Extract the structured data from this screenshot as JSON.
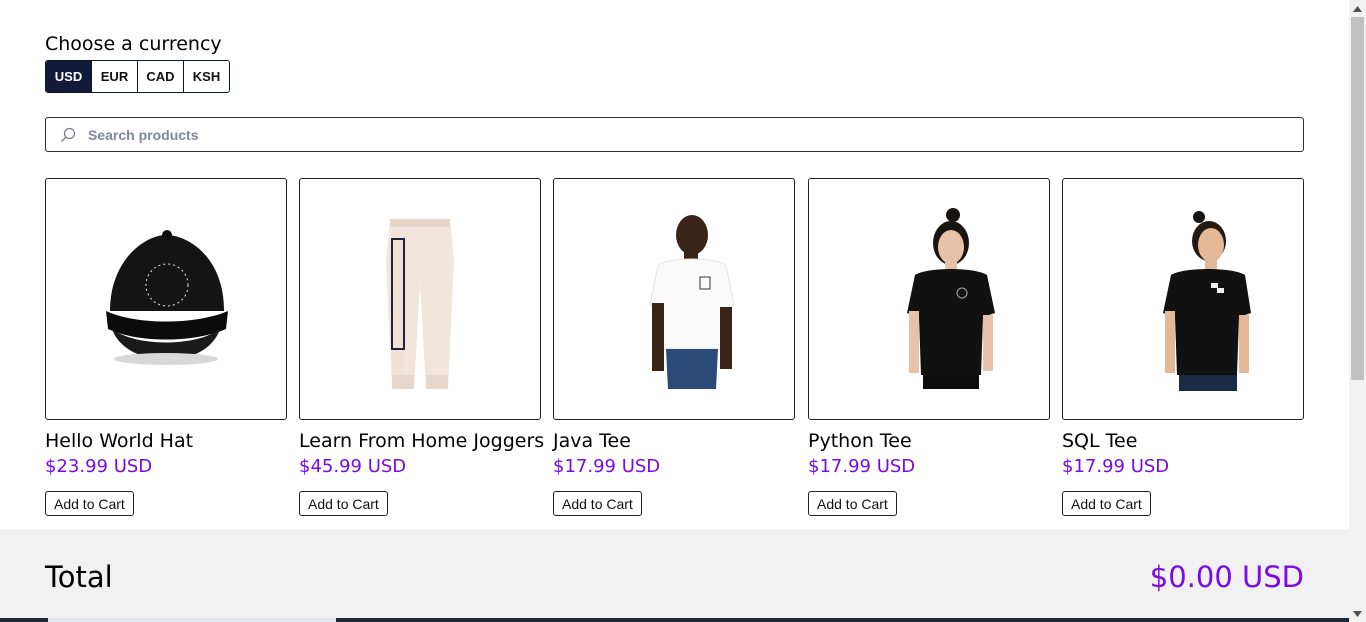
{
  "currency": {
    "title": "Choose a currency",
    "options": [
      "USD",
      "EUR",
      "CAD",
      "KSH"
    ],
    "selected": "USD"
  },
  "search": {
    "placeholder": "Search products",
    "value": ""
  },
  "products": [
    {
      "name": "Hello World Hat",
      "price": "$23.99 USD",
      "add_label": "Add to Cart",
      "image": "cap-photo"
    },
    {
      "name": "Learn From Home Joggers",
      "price": "$45.99 USD",
      "add_label": "Add to Cart",
      "image": "joggers-photo"
    },
    {
      "name": "Java Tee",
      "price": "$17.99 USD",
      "add_label": "Add to Cart",
      "image": "white-tee-photo"
    },
    {
      "name": "Python Tee",
      "price": "$17.99 USD",
      "add_label": "Add to Cart",
      "image": "black-tee-woman-photo"
    },
    {
      "name": "SQL Tee",
      "price": "$17.99 USD",
      "add_label": "Add to Cart",
      "image": "black-tee-man-photo"
    }
  ],
  "cart": {
    "total_label": "Total",
    "total_value": "$0.00 USD"
  },
  "colors": {
    "accent": "#7a0ae6",
    "selected_currency_bg": "#121a3c",
    "footer_bg": "#f1f1f1"
  }
}
